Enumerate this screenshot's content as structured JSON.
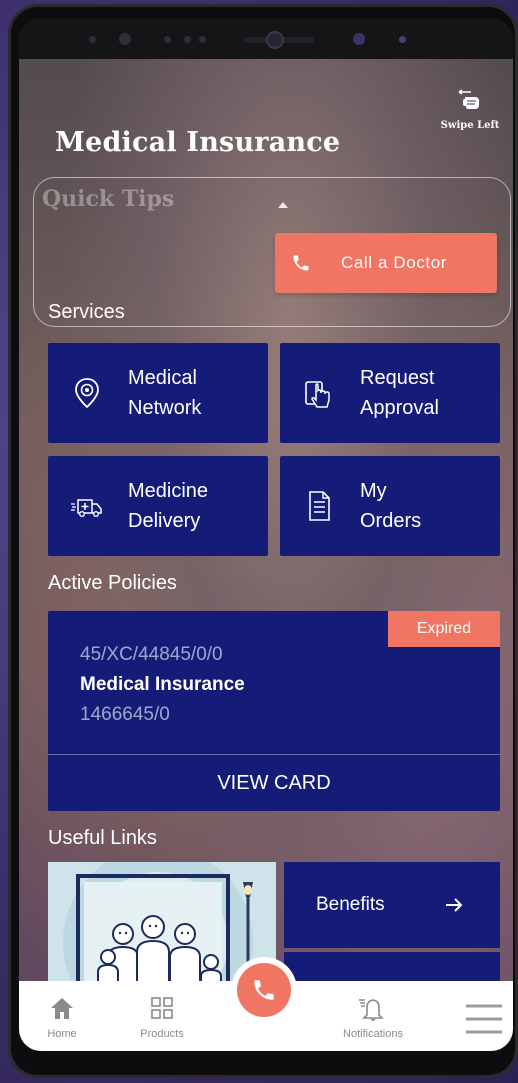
{
  "header": {
    "title": "Medical Insurance",
    "swipe_label": "Swipe Left"
  },
  "quick_tips": {
    "title": "Quick Tips"
  },
  "call_button": {
    "label": "Call a Doctor"
  },
  "services": {
    "label": "Services",
    "items": [
      {
        "label": "Medical\nNetwork",
        "icon": "location-pin-icon"
      },
      {
        "label": "Request\nApproval",
        "icon": "hand-tap-icon"
      },
      {
        "label": "Medicine\nDelivery",
        "icon": "ambulance-icon"
      },
      {
        "label": "My\nOrders",
        "icon": "document-icon"
      }
    ]
  },
  "active_policies": {
    "label": "Active Policies",
    "policy": {
      "badge": "Expired",
      "number": "45/XC/44845/0/0",
      "name": "Medical Insurance",
      "id": "1466645/0",
      "action": "VIEW CARD"
    }
  },
  "useful_links": {
    "label": "Useful Links",
    "items": [
      {
        "label": "Benefits",
        "icon": "arrow-right-icon"
      }
    ]
  },
  "bottom_nav": {
    "items": [
      {
        "label": "Home",
        "icon": "home-icon"
      },
      {
        "label": "Products",
        "icon": "grid-icon"
      },
      {
        "label": "",
        "icon": "phone-icon"
      },
      {
        "label": "Notifications",
        "icon": "bell-icon"
      },
      {
        "label": "",
        "icon": "menu-icon"
      }
    ]
  },
  "colors": {
    "primary": "#141c78",
    "accent": "#f07563",
    "nav_text": "#8a8a8a"
  }
}
